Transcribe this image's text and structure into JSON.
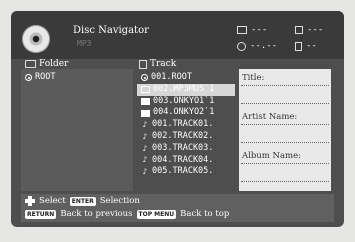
{
  "header": {
    "title": "Disc Navigator",
    "subtitle": "MP3",
    "info": {
      "folder_count": "---",
      "track_count": "---",
      "time": "--.--",
      "doc_count": "--"
    }
  },
  "folder_panel": {
    "label": "Folder",
    "items": [
      {
        "label": "ROOT",
        "icon": "radio-icon"
      }
    ]
  },
  "track_panel": {
    "label": "Track",
    "items": [
      {
        "label": "001.ROOT",
        "icon": "radio-icon"
      },
      {
        "label": "002.MP3MUS`1",
        "icon": "open-folder-icon",
        "selected": true
      },
      {
        "label": "003.ONKYO1`1",
        "icon": "folder-icon"
      },
      {
        "label": "004.ONKYO2`1",
        "icon": "folder-icon"
      },
      {
        "label": "001.TRACK01.",
        "icon": "music-note-icon"
      },
      {
        "label": "002.TRACK02.",
        "icon": "music-note-icon"
      },
      {
        "label": "003.TRACK03.",
        "icon": "music-note-icon"
      },
      {
        "label": "004.TRACK04.",
        "icon": "music-note-icon"
      },
      {
        "label": "005.TRACK05.",
        "icon": "music-note-icon"
      }
    ]
  },
  "meta_panel": {
    "title_label": "Title:",
    "artist_label": "Artist Name:",
    "album_label": "Album Name:"
  },
  "footer": {
    "select_label": "Select",
    "enter_key": "ENTER",
    "enter_label": "Selection",
    "return_key": "RETURN",
    "return_label": "Back to previous",
    "topmenu_key": "TOP MENU",
    "topmenu_label": "Back to top"
  }
}
